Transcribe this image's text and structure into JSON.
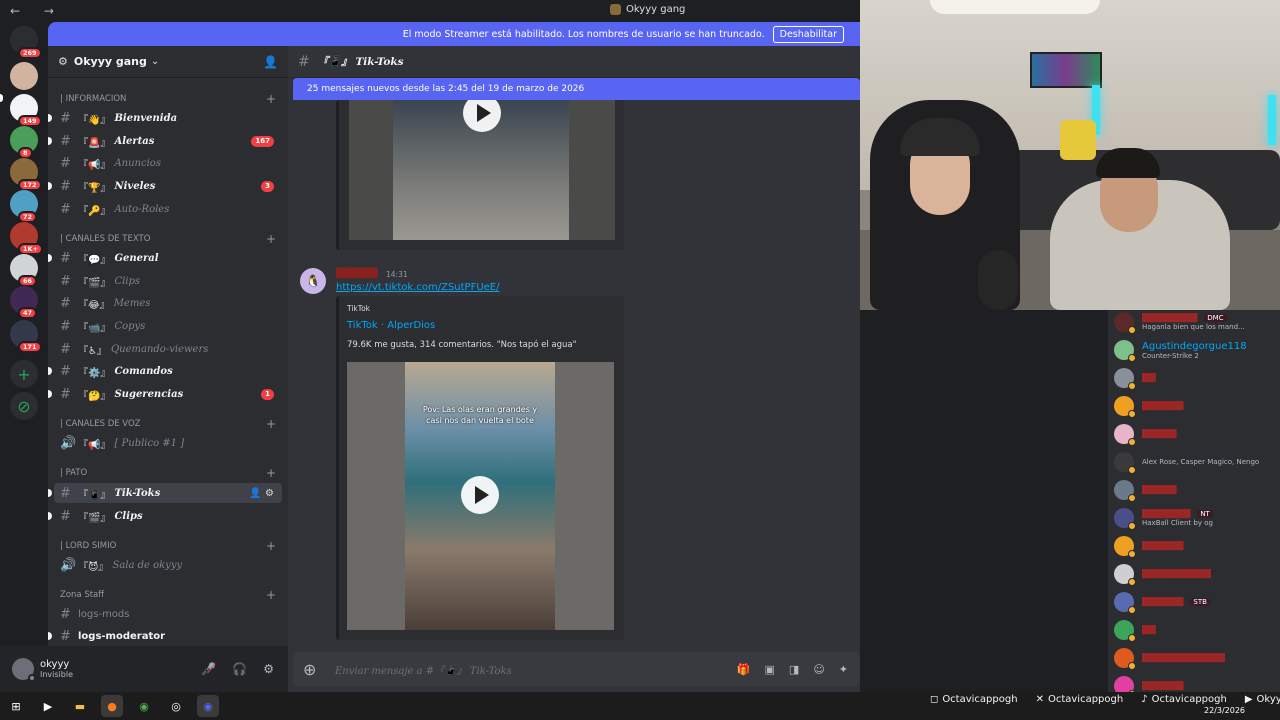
{
  "window": {
    "title": "Okyyy gang",
    "nav": "← →"
  },
  "banner": {
    "text": "El modo Streamer está habilitado. Los nombres de usuario se han truncado.",
    "button": "Deshabilitar"
  },
  "rail": {
    "servers": [
      {
        "badge": "269"
      },
      {
        "badge": ""
      },
      {
        "badge": "149"
      },
      {
        "badge": "8"
      },
      {
        "badge": "172"
      },
      {
        "badge": "72"
      },
      {
        "badge": "1K+"
      },
      {
        "badge": "66"
      },
      {
        "badge": "47"
      },
      {
        "badge": "171"
      }
    ],
    "add_icon": "+",
    "explore_icon": "⊘"
  },
  "sidebar": {
    "server_name": "Okyyy gang",
    "server_chevron": "⌄",
    "categories": {
      "informacion": "| INFORMACION",
      "texto": "| CANALES DE TEXTO",
      "voz": "| CANALES DE VOZ",
      "pato": "| PATO",
      "lord": "| LORD SIMIO",
      "staff": "Zona Staff"
    },
    "channels": [
      {
        "emoji": "『👋』",
        "name": "Bienvenida"
      },
      {
        "emoji": "『🚨』",
        "name": "Alertas",
        "badge": "167"
      },
      {
        "emoji": "『📢』",
        "name": "Anuncios"
      },
      {
        "emoji": "『🏆』",
        "name": "Niveles",
        "badge": "3"
      },
      {
        "emoji": "『🔑』",
        "name": "Auto-Roles"
      },
      {
        "emoji": "『💬』",
        "name": "General"
      },
      {
        "emoji": "『🎬』",
        "name": "Clips"
      },
      {
        "emoji": "『😂』",
        "name": "Memes"
      },
      {
        "emoji": "『📹』",
        "name": "Copys"
      },
      {
        "emoji": "『♿』",
        "name": "Quemando-viewers"
      },
      {
        "emoji": "『⚙️』",
        "name": "Comandos"
      },
      {
        "emoji": "『🤔』",
        "name": "Sugerencias",
        "badge": "1"
      },
      {
        "emoji": "『📢』",
        "name": "[ Publico #1 ]"
      },
      {
        "emoji": "『📱』",
        "name": "Tik-Toks"
      },
      {
        "emoji": "『🎬』",
        "name": "Clips"
      },
      {
        "emoji": "『😈』",
        "name": "Sala de okyyy"
      },
      {
        "emoji": "",
        "name": "logs-mods"
      },
      {
        "emoji": "",
        "name": "logs-moderator"
      }
    ]
  },
  "user": {
    "name": "okyyy",
    "status": "Invisible"
  },
  "chat": {
    "channel_name": "『📱』 Tik-Toks",
    "new_messages": "25 mensajes nuevos desde las 2:45 del 19 de marzo de 2026",
    "message": {
      "time": "14:31",
      "link": "https://vt.tiktok.com/ZSutPFUeE/",
      "embed_provider": "TikTok",
      "embed_title": "TikTok · AlperDios",
      "embed_desc": "79.6K me gusta, 314 comentarios. \"Nos tapó el agua\"",
      "video_caption": "Pov: Las olas eran grandes y casi nos dan vuelta el bote"
    },
    "composer_placeholder": "Enviar mensaje a #『📱』 Tik-Toks"
  },
  "stream_chat": {
    "rows": [
      {
        "name": "",
        "sub": "Haganla bien que los mand...",
        "tag": "DMC"
      },
      {
        "name": "Agustindegorgue118",
        "sub": "Counter-Strike 2",
        "tag": ""
      },
      {
        "name": "",
        "sub": "",
        "tag": ""
      },
      {
        "name": "",
        "sub": "",
        "tag": ""
      },
      {
        "name": "",
        "sub": "",
        "tag": ""
      },
      {
        "name": "",
        "sub": "Alex Rose, Casper Magico, Ñengo",
        "tag": ""
      },
      {
        "name": "",
        "sub": "",
        "tag": ""
      },
      {
        "name": "",
        "sub": "HaxBall Client by og",
        "tag": "NT"
      },
      {
        "name": "",
        "sub": "",
        "tag": ""
      },
      {
        "name": "",
        "sub": "",
        "tag": ""
      },
      {
        "name": "",
        "sub": "",
        "tag": "STB"
      },
      {
        "name": "",
        "sub": "",
        "tag": ""
      },
      {
        "name": "",
        "sub": "",
        "tag": ""
      },
      {
        "name": "",
        "sub": "",
        "tag": ""
      }
    ]
  },
  "overlay": {
    "instagram": "Octavicappogh",
    "x": "Octavicappogh",
    "tiktok": "Octavicappogh",
    "youtube": "Okyyy"
  },
  "clock": {
    "date": "22/3/2026"
  },
  "colors": {
    "accent": "#5865f2",
    "danger": "#f23f43",
    "link": "#00a8fc"
  }
}
